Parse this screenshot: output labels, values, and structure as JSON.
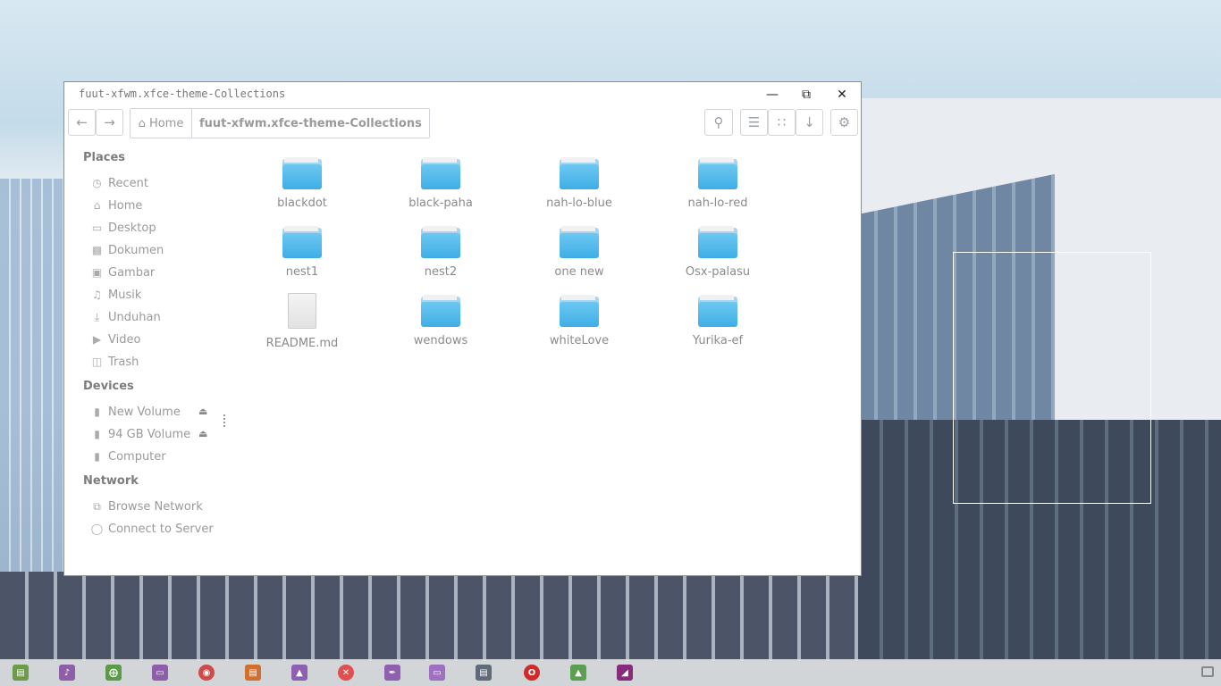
{
  "window": {
    "title": "fuut-xfwm.xfce-theme-Collections"
  },
  "toolbar": {
    "back_icon": "arrow-left-icon",
    "forward_icon": "arrow-right-icon",
    "crumbs": {
      "home": "Home",
      "current": "fuut-xfwm.xfce-theme-Collections"
    },
    "search_icon": "search-icon",
    "list_view_icon": "list-view-icon",
    "grid_view_icon": "grid-view-icon",
    "sort_icon": "arrow-down-icon",
    "menu_icon": "gear-icon"
  },
  "sidebar": {
    "places_label": "Places",
    "places": [
      {
        "label": "Recent",
        "icon": "clock-icon"
      },
      {
        "label": "Home",
        "icon": "home-icon"
      },
      {
        "label": "Desktop",
        "icon": "desktop-icon"
      },
      {
        "label": "Dokumen",
        "icon": "document-icon"
      },
      {
        "label": "Gambar",
        "icon": "picture-icon"
      },
      {
        "label": "Musik",
        "icon": "music-icon"
      },
      {
        "label": "Unduhan",
        "icon": "download-icon"
      },
      {
        "label": "Video",
        "icon": "video-icon"
      },
      {
        "label": "Trash",
        "icon": "trash-icon"
      }
    ],
    "devices_label": "Devices",
    "devices": [
      {
        "label": "New Volume",
        "icon": "drive-icon",
        "ejectable": true
      },
      {
        "label": "94 GB Volume",
        "icon": "drive-icon",
        "ejectable": true
      },
      {
        "label": "Computer",
        "icon": "drive-icon",
        "ejectable": false
      }
    ],
    "network_label": "Network",
    "network": [
      {
        "label": "Browse Network",
        "icon": "network-icon"
      },
      {
        "label": "Connect to Server",
        "icon": "globe-icon"
      }
    ]
  },
  "files": [
    {
      "name": "blackdot",
      "type": "folder"
    },
    {
      "name": "black-paha",
      "type": "folder"
    },
    {
      "name": "nah-lo-blue",
      "type": "folder"
    },
    {
      "name": "nah-lo-red",
      "type": "folder"
    },
    {
      "name": "nest1",
      "type": "folder"
    },
    {
      "name": "nest2",
      "type": "folder"
    },
    {
      "name": "one new",
      "type": "folder"
    },
    {
      "name": "Osx-palasu",
      "type": "folder"
    },
    {
      "name": "README.md",
      "type": "file"
    },
    {
      "name": "wendows",
      "type": "folder"
    },
    {
      "name": "whiteLove",
      "type": "folder"
    },
    {
      "name": "Yurika-ef",
      "type": "folder"
    }
  ],
  "taskbar": {
    "apps": [
      {
        "icon": "app-1-icon",
        "color": "#6e9a4a"
      },
      {
        "icon": "app-2-icon",
        "color": "#8e5fa8"
      },
      {
        "icon": "app-3-icon",
        "color": "#5c9a4a"
      },
      {
        "icon": "app-4-icon",
        "color": "#8e5fa8"
      },
      {
        "icon": "app-5-icon",
        "color": "#d04a4a"
      },
      {
        "icon": "app-6-icon",
        "color": "#d07030"
      },
      {
        "icon": "app-7-icon",
        "color": "#9060b0"
      },
      {
        "icon": "app-8-icon",
        "color": "#e05050"
      },
      {
        "icon": "app-9-icon",
        "color": "#9060b0"
      },
      {
        "icon": "folder-icon",
        "color": "#a070c0"
      },
      {
        "icon": "browser-icon",
        "color": "#606a78"
      },
      {
        "icon": "opera-icon",
        "color": "#d02a2a"
      },
      {
        "icon": "image-viewer-icon",
        "color": "#5aa050"
      },
      {
        "icon": "app-14-icon",
        "color": "#8a2a7a"
      }
    ]
  }
}
